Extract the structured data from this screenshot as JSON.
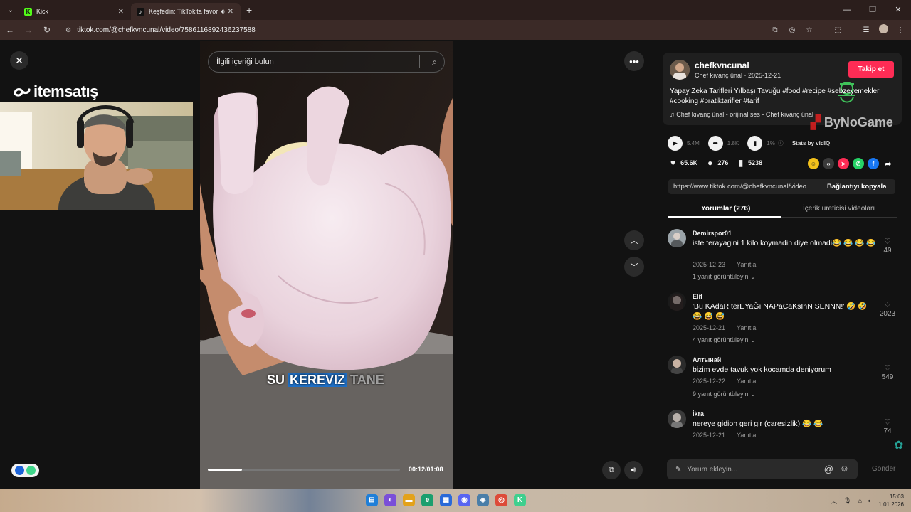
{
  "browser": {
    "tabs": [
      {
        "title": "Kick",
        "active": false
      },
      {
        "title": "Keşfedin: TikTok'ta favori vi",
        "active": true
      }
    ],
    "url": "tiktok.com/@chefkvncunal/video/7586116892436237588"
  },
  "overlay": {
    "brand": "itemsatış"
  },
  "video": {
    "search_placeholder": "İlgili içeriği bulun",
    "subtitle_pre": "SU ",
    "subtitle_highlight": "KEREVIZ",
    "subtitle_post": " TANE",
    "time": "00:12/01:08",
    "progress": 0.177
  },
  "creator": {
    "handle": "chefkvncunal",
    "name_date": "Chef kıvanç ünal · 2025-12-21",
    "follow_label": "Takip et",
    "description": "Yapay Zeka Tarifleri Yılbaşı Tavuğu #food #recipe #sebzeyemekleri #cooking #pratiktarifler #tarif",
    "music": "Chef kıvanç ünal - orijinal ses - Chef kıvanç ünal",
    "watermark": "ByNoGame"
  },
  "stats": {
    "plays": "5.4M",
    "shares_stat": "1.8K",
    "rate": "1%",
    "vidiq_label": "Stats by vidIQ"
  },
  "actions": {
    "likes": "65.6K",
    "comments": "276",
    "saves": "5238"
  },
  "link": {
    "url": "https://www.tiktok.com/@chefkvncunal/video...",
    "copy_label": "Bağlantıyı kopyala"
  },
  "tabs": {
    "comments_tab": "Yorumlar (276)",
    "creator_videos_tab": "İçerik üreticisi videoları"
  },
  "comments": [
    {
      "user": "Demirspor01",
      "text": "iste terayagini 1 kilo koymadin diye olmadi😂 😂 😂 😂",
      "date": "2025-12-23",
      "reply": "Yanıtla",
      "replies": "1 yanıt görüntüleyin",
      "likes": "49"
    },
    {
      "user": "Elif",
      "text": "'Bu KAdaR terEYaĞı NAPaCaKsInN SENNN!' 🤣 🤣 😂 😅 😅",
      "date": "2025-12-21",
      "reply": "Yanıtla",
      "replies": "4 yanıt görüntüleyin",
      "likes": "2023"
    },
    {
      "user": "Алтынай",
      "text": "bizim evde tavuk yok kocamda deniyorum",
      "date": "2025-12-22",
      "reply": "Yanıtla",
      "replies": "9 yanıt görüntüleyin",
      "likes": "549"
    },
    {
      "user": "İkra",
      "text": "nereye gidion geri gir (çaresizlik) 😂 😂",
      "date": "2025-12-21",
      "reply": "Yanıtla",
      "replies": "",
      "likes": "74"
    }
  ],
  "comment_input": {
    "placeholder": "Yorum ekleyin...",
    "send_label": "Gönder"
  },
  "taskbar": {
    "time": "15:03",
    "date": "1.01.2026"
  }
}
